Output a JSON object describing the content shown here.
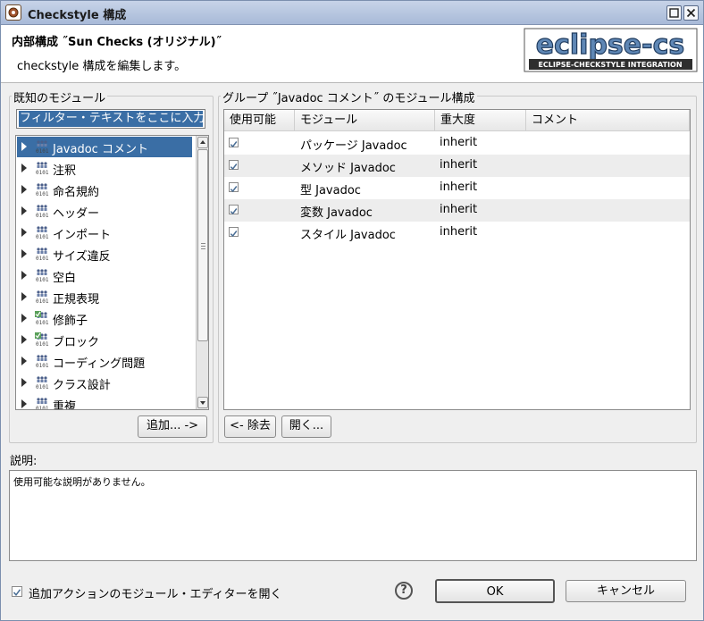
{
  "window": {
    "title": "Checkstyle 構成"
  },
  "header": {
    "title": "内部構成 ˝Sun Checks (オリジナル)˝",
    "description": "checkstyle 構成を編集します。",
    "logo_main": "eclipse-cs",
    "logo_sub": "ECLIPSE-CHECKSTYLE INTEGRATION"
  },
  "known_modules": {
    "label": "既知のモジュール",
    "filter_value": "フィルター・テキストをここに入力",
    "items": [
      {
        "label": "Javadoc コメント",
        "icon": "module-group-icon",
        "selected": true
      },
      {
        "label": "注釈",
        "icon": "module-group-icon"
      },
      {
        "label": "命名規約",
        "icon": "module-group-icon"
      },
      {
        "label": "ヘッダー",
        "icon": "module-group-icon"
      },
      {
        "label": "インポート",
        "icon": "module-group-icon"
      },
      {
        "label": "サイズ違反",
        "icon": "module-group-icon"
      },
      {
        "label": "空白",
        "icon": "module-group-icon"
      },
      {
        "label": "正規表現",
        "icon": "module-group-icon"
      },
      {
        "label": "修飾子",
        "icon": "module-group-checked-icon"
      },
      {
        "label": "ブロック",
        "icon": "module-group-checked-icon"
      },
      {
        "label": "コーディング問題",
        "icon": "module-group-icon"
      },
      {
        "label": "クラス設計",
        "icon": "module-group-icon"
      },
      {
        "label": "重複",
        "icon": "module-group-icon"
      }
    ],
    "add_button": "追加... ->"
  },
  "group_config": {
    "label": "グループ ˝Javadoc コメント˝ のモジュール構成",
    "columns": [
      "使用可能",
      "モジュール",
      "重大度",
      "コメント"
    ],
    "rows": [
      {
        "enabled": true,
        "module": "パッケージ Javadoc",
        "severity": "inherit",
        "comment": ""
      },
      {
        "enabled": true,
        "module": "メソッド Javadoc",
        "severity": "inherit",
        "comment": ""
      },
      {
        "enabled": true,
        "module": "型 Javadoc",
        "severity": "inherit",
        "comment": ""
      },
      {
        "enabled": true,
        "module": "変数 Javadoc",
        "severity": "inherit",
        "comment": ""
      },
      {
        "enabled": true,
        "module": "スタイル Javadoc",
        "severity": "inherit",
        "comment": ""
      }
    ],
    "remove_button": "<- 除去",
    "open_button": "開く..."
  },
  "description": {
    "label": "説明:",
    "text": "使用可能な説明がありません。"
  },
  "footer": {
    "open_editor_label": "追加アクションのモジュール・エディターを開く",
    "open_editor_checked": true,
    "help_glyph": "?",
    "ok_label": "OK",
    "cancel_label": "キャンセル"
  },
  "colors": {
    "selection": "#3a6ea5",
    "titlebar": "#a8bad8"
  }
}
